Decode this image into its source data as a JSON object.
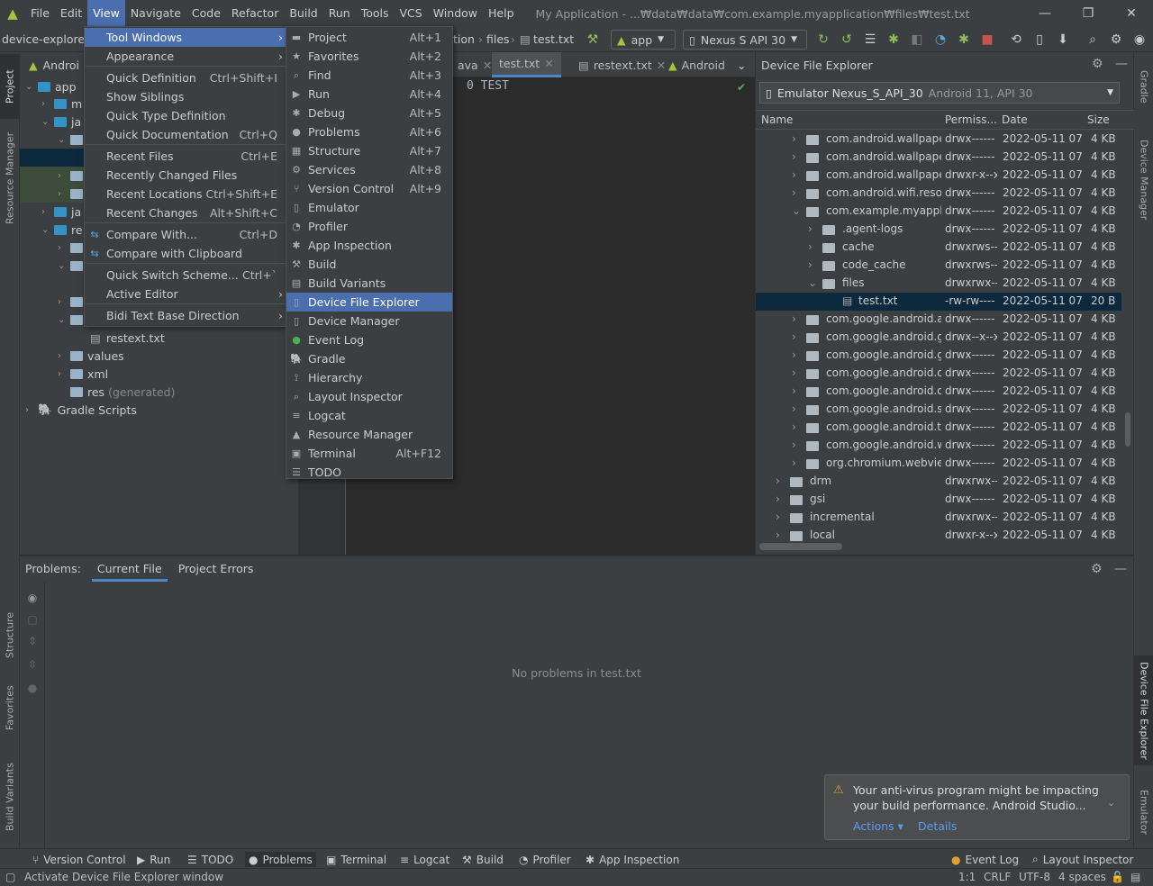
{
  "window": {
    "title": "My Application - ...₩data₩data₩com.example.myapplication₩files₩test.txt",
    "menu": [
      "File",
      "Edit",
      "View",
      "Navigate",
      "Code",
      "Refactor",
      "Build",
      "Run",
      "Tools",
      "VCS",
      "Window",
      "Help"
    ],
    "controls": [
      "—",
      "❐",
      "✕"
    ]
  },
  "navbar": {
    "crumbs": [
      "device-explorer",
      "tion",
      "files",
      "test.txt"
    ],
    "run_config": "app",
    "device": "Nexus S API 30"
  },
  "left_stripe": [
    "Project",
    "Resource Manager",
    "Structure",
    "Favorites",
    "Build Variants"
  ],
  "right_stripe": [
    "Gradle",
    "Device Manager",
    "Device File Explorer",
    "Emulator"
  ],
  "project": {
    "header": "Androi",
    "tree": [
      {
        "label": "app"
      },
      {
        "label": "m"
      },
      {
        "label": "ja"
      },
      {
        "label": ""
      },
      {
        "label": ""
      },
      {
        "label": ""
      },
      {
        "label": ""
      },
      {
        "label": "ja"
      },
      {
        "label": "re"
      },
      {
        "label": ""
      },
      {
        "label": ""
      },
      {
        "label": ""
      },
      {
        "label": ""
      },
      {
        "label": "restext.txt"
      },
      {
        "label": "values"
      },
      {
        "label": "xml"
      },
      {
        "label": "res",
        "suffix": "(generated)"
      },
      {
        "label": "Gradle Scripts"
      }
    ]
  },
  "editor": {
    "tabs": [
      "ava",
      "test.txt",
      "restext.txt",
      "Android"
    ],
    "code": "0 TEST"
  },
  "view_menu": {
    "items": [
      {
        "label": "Tool Windows",
        "key": "",
        "arrow": true
      },
      {
        "label": "Appearance",
        "key": "",
        "arrow": true
      },
      {
        "label": "Quick Definition",
        "key": "Ctrl+Shift+I"
      },
      {
        "label": "Show Siblings",
        "key": ""
      },
      {
        "label": "Quick Type Definition",
        "key": ""
      },
      {
        "label": "Quick Documentation",
        "key": "Ctrl+Q"
      },
      {
        "label": "Recent Files",
        "key": "Ctrl+E"
      },
      {
        "label": "Recently Changed Files",
        "key": ""
      },
      {
        "label": "Recent Locations",
        "key": "Ctrl+Shift+E"
      },
      {
        "label": "Recent Changes",
        "key": "Alt+Shift+C"
      },
      {
        "label": "Compare With...",
        "key": "Ctrl+D"
      },
      {
        "label": "Compare with Clipboard",
        "key": ""
      },
      {
        "label": "Quick Switch Scheme...",
        "key": "Ctrl+`"
      },
      {
        "label": "Active Editor",
        "key": "",
        "arrow": true
      },
      {
        "label": "Bidi Text Base Direction",
        "key": "",
        "arrow": true
      }
    ]
  },
  "tool_windows_menu": {
    "items": [
      {
        "label": "Project",
        "key": "Alt+1"
      },
      {
        "label": "Favorites",
        "key": "Alt+2"
      },
      {
        "label": "Find",
        "key": "Alt+3"
      },
      {
        "label": "Run",
        "key": "Alt+4"
      },
      {
        "label": "Debug",
        "key": "Alt+5"
      },
      {
        "label": "Problems",
        "key": "Alt+6"
      },
      {
        "label": "Structure",
        "key": "Alt+7"
      },
      {
        "label": "Services",
        "key": "Alt+8"
      },
      {
        "label": "Version Control",
        "key": "Alt+9"
      },
      {
        "label": "Emulator",
        "key": ""
      },
      {
        "label": "Profiler",
        "key": ""
      },
      {
        "label": "App Inspection",
        "key": ""
      },
      {
        "label": "Build",
        "key": ""
      },
      {
        "label": "Build Variants",
        "key": ""
      },
      {
        "label": "Device File Explorer",
        "key": ""
      },
      {
        "label": "Device Manager",
        "key": ""
      },
      {
        "label": "Event Log",
        "key": ""
      },
      {
        "label": "Gradle",
        "key": ""
      },
      {
        "label": "Hierarchy",
        "key": ""
      },
      {
        "label": "Layout Inspector",
        "key": ""
      },
      {
        "label": "Logcat",
        "key": ""
      },
      {
        "label": "Resource Manager",
        "key": ""
      },
      {
        "label": "Terminal",
        "key": "Alt+F12"
      },
      {
        "label": "TODO",
        "key": ""
      }
    ]
  },
  "dfe": {
    "title": "Device File Explorer",
    "device": "Emulator Nexus_S_API_30",
    "device_info": "Android 11, API 30",
    "columns": [
      "Name",
      "Permiss...",
      "Date",
      "Size"
    ],
    "rows": [
      {
        "name": "com.android.wallpaperb",
        "perm": "drwx------",
        "date": "2022-05-11 07:",
        "size": "4 KB"
      },
      {
        "name": "com.android.wallpaperc",
        "perm": "drwx------",
        "date": "2022-05-11 07:",
        "size": "4 KB"
      },
      {
        "name": "com.android.wallpaperp",
        "perm": "drwxr-x--x",
        "date": "2022-05-11 07:",
        "size": "4 KB"
      },
      {
        "name": "com.android.wifi.resour",
        "perm": "drwx------",
        "date": "2022-05-11 07:",
        "size": "4 KB"
      },
      {
        "name": "com.example.myapplica",
        "perm": "drwx------",
        "date": "2022-05-11 07:",
        "size": "4 KB"
      },
      {
        "name": ".agent-logs",
        "perm": "drwx------",
        "date": "2022-05-11 07:",
        "size": "4 KB"
      },
      {
        "name": "cache",
        "perm": "drwxrws--)",
        "date": "2022-05-11 07:",
        "size": "4 KB"
      },
      {
        "name": "code_cache",
        "perm": "drwxrws--)",
        "date": "2022-05-11 07:",
        "size": "4 KB"
      },
      {
        "name": "files",
        "perm": "drwxrwx--:",
        "date": "2022-05-11 07:",
        "size": "4 KB"
      },
      {
        "name": "test.txt",
        "perm": "-rw-rw----",
        "date": "2022-05-11 07:",
        "size": "20 B"
      },
      {
        "name": "com.google.android.ap",
        "perm": "drwx------",
        "date": "2022-05-11 07:",
        "size": "4 KB"
      },
      {
        "name": "com.google.android.gm",
        "perm": "drwx--x--x",
        "date": "2022-05-11 07:",
        "size": "4 KB"
      },
      {
        "name": "com.google.android.gsf",
        "perm": "drwx------",
        "date": "2022-05-11 07:",
        "size": "4 KB"
      },
      {
        "name": "com.google.android.ov",
        "perm": "drwx------",
        "date": "2022-05-11 07:",
        "size": "4 KB"
      },
      {
        "name": "com.google.android.ov",
        "perm": "drwx------",
        "date": "2022-05-11 07:",
        "size": "4 KB"
      },
      {
        "name": "com.google.android.sdl",
        "perm": "drwx------",
        "date": "2022-05-11 07:",
        "size": "4 KB"
      },
      {
        "name": "com.google.android.tric",
        "perm": "drwx------",
        "date": "2022-05-11 07:",
        "size": "4 KB"
      },
      {
        "name": "com.google.android.we",
        "perm": "drwx------",
        "date": "2022-05-11 07:",
        "size": "4 KB"
      },
      {
        "name": "org.chromium.webview",
        "perm": "drwx------",
        "date": "2022-05-11 07:",
        "size": "4 KB"
      },
      {
        "name": "drm",
        "perm": "drwxrwx---",
        "date": "2022-05-11 07:",
        "size": "4 KB"
      },
      {
        "name": "gsi",
        "perm": "drwx------",
        "date": "2022-05-11 07:",
        "size": "4 KB"
      },
      {
        "name": "incremental",
        "perm": "drwxrwx--:",
        "date": "2022-05-11 07:",
        "size": "4 KB"
      },
      {
        "name": "local",
        "perm": "drwxr-x--x",
        "date": "2022-05-11 07:",
        "size": "4 KB"
      }
    ]
  },
  "problems": {
    "label": "Problems:",
    "tabs": [
      "Current File",
      "Project Errors"
    ],
    "empty": "No problems in test.txt"
  },
  "notification": {
    "text": "Your anti-virus program might be impacting your build performance. Android Studio...",
    "actions": "Actions ▾",
    "details": "Details"
  },
  "bottom_tools": [
    "Version Control",
    "Run",
    "TODO",
    "Problems",
    "Terminal",
    "Logcat",
    "Build",
    "Profiler",
    "App Inspection"
  ],
  "bottom_right": [
    "Event Log",
    "Layout Inspector"
  ],
  "status": {
    "message": "Activate Device File Explorer window",
    "pos": "1:1",
    "eol": "CRLF",
    "enc": "UTF-8",
    "indent": "4 spaces"
  },
  "colors": {
    "accent": "#4b6eaf",
    "selection": "#0d293e",
    "android": "#a4c639"
  }
}
